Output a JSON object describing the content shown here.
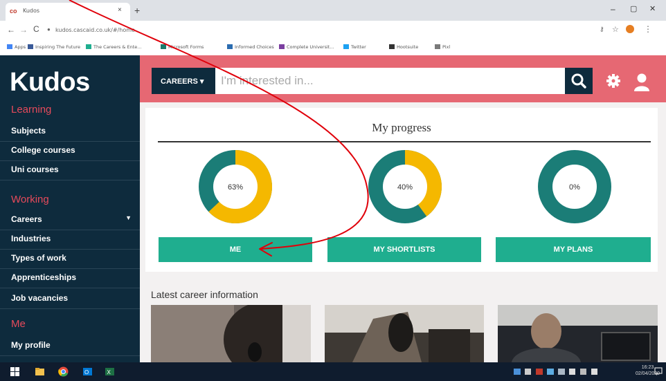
{
  "browser": {
    "tab_icon": "co",
    "tab_title": "Kudos",
    "tab_close": "×",
    "new_tab": "+",
    "window_controls": {
      "minimize": "–",
      "maximize": "▢",
      "close": "✕"
    },
    "nav": {
      "back": "←",
      "forward": "→",
      "reload": "C"
    },
    "url": "kudos.cascaid.co.uk/#/home",
    "bookmarks": [
      {
        "label": "Apps",
        "color": "#4285f4"
      },
      {
        "label": "Inspiring The Future",
        "color": "#3a5a98"
      },
      {
        "label": "The Careers & Ente...",
        "color": "#1fae8f"
      },
      {
        "label": "Microsoft Forms",
        "color": "#1b7a6b"
      },
      {
        "label": "Informed Choices",
        "color": "#2b6cb0"
      },
      {
        "label": "Complete Universit...",
        "color": "#7b3fa0"
      },
      {
        "label": "Twitter",
        "color": "#1da1f2"
      },
      {
        "label": "Hootsuite",
        "color": "#333333"
      },
      {
        "label": "Pixl",
        "color": "#7a7a7a"
      }
    ]
  },
  "app": {
    "logo": "Kudos",
    "colors": {
      "navy": "#0e2b3d",
      "coral": "#e66873",
      "teal": "#1b7d77",
      "yellow": "#f5b800",
      "green": "#1fae8f"
    },
    "sidebar": {
      "sections": [
        {
          "title": "Learning",
          "items": [
            "Subjects",
            "College courses",
            "Uni courses"
          ]
        },
        {
          "title": "Working",
          "items": [
            "Careers",
            "Industries",
            "Types of work",
            "Apprenticeships",
            "Job vacancies"
          ]
        },
        {
          "title": "Me",
          "items": [
            "My profile"
          ]
        }
      ]
    },
    "header": {
      "careers_button": "CAREERS ▾",
      "search_placeholder": "I'm interested in...",
      "icons": [
        "search-icon",
        "gear-icon",
        "user-icon"
      ]
    },
    "progress": {
      "title": "My progress",
      "items": [
        {
          "label": "63%",
          "value": 63,
          "button": "ME"
        },
        {
          "label": "40%",
          "value": 40,
          "button": "MY SHORTLISTS"
        },
        {
          "label": "0%",
          "value": 0,
          "button": "MY PLANS"
        }
      ]
    },
    "latest": {
      "title": "Latest career information"
    }
  },
  "taskbar": {
    "time": "16:23",
    "date": "02/04/2020"
  }
}
